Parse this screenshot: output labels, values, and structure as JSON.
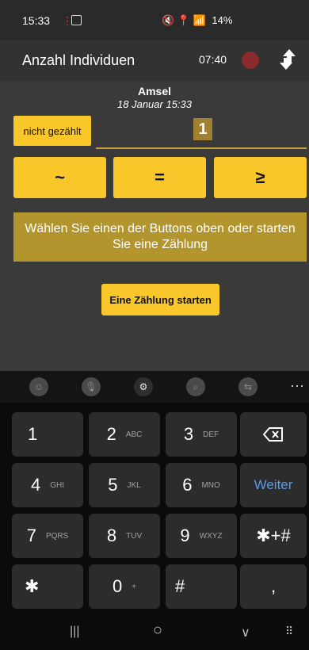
{
  "status_bar": {
    "time": "15:33",
    "rec_indicator": "⋮",
    "icons": "🔇  📍  📶",
    "battery": "14%"
  },
  "app_bar": {
    "title": "Anzahl Individuen",
    "timer": "07:40"
  },
  "observation": {
    "species": "Amsel",
    "datetime": "18 Januar 15:33"
  },
  "counter": {
    "not_counted_label": "nicht gezählt",
    "value": "1"
  },
  "operators": [
    "~",
    "=",
    "≥"
  ],
  "info_text": "Wählen Sie einen der Buttons oben oder starten Sie eine Zählung",
  "start_button": "Eine Zählung starten",
  "keyboard": {
    "keys": [
      {
        "digit": "1",
        "letters": ""
      },
      {
        "digit": "2",
        "letters": "ABC"
      },
      {
        "digit": "3",
        "letters": "DEF"
      },
      {
        "digit": "4",
        "letters": "GHI"
      },
      {
        "digit": "5",
        "letters": "JKL"
      },
      {
        "digit": "6",
        "letters": "MNO"
      },
      {
        "digit": "7",
        "letters": "PQRS"
      },
      {
        "digit": "8",
        "letters": "TUV"
      },
      {
        "digit": "9",
        "letters": "WXYZ"
      },
      {
        "digit": "✱",
        "letters": ""
      },
      {
        "digit": "0",
        "letters": "+"
      },
      {
        "digit": "#",
        "letters": ""
      }
    ],
    "backspace": "⌫",
    "next_label": "Weiter",
    "symbols_label": "✱+#",
    "comma": ","
  },
  "nav": {
    "recents": "|||",
    "home": "○",
    "back": "∨",
    "keyboard_hide": "⠿"
  },
  "colors": {
    "accent": "#fac72b",
    "info_bg": "#b3952e",
    "weiter": "#5b9be6"
  }
}
